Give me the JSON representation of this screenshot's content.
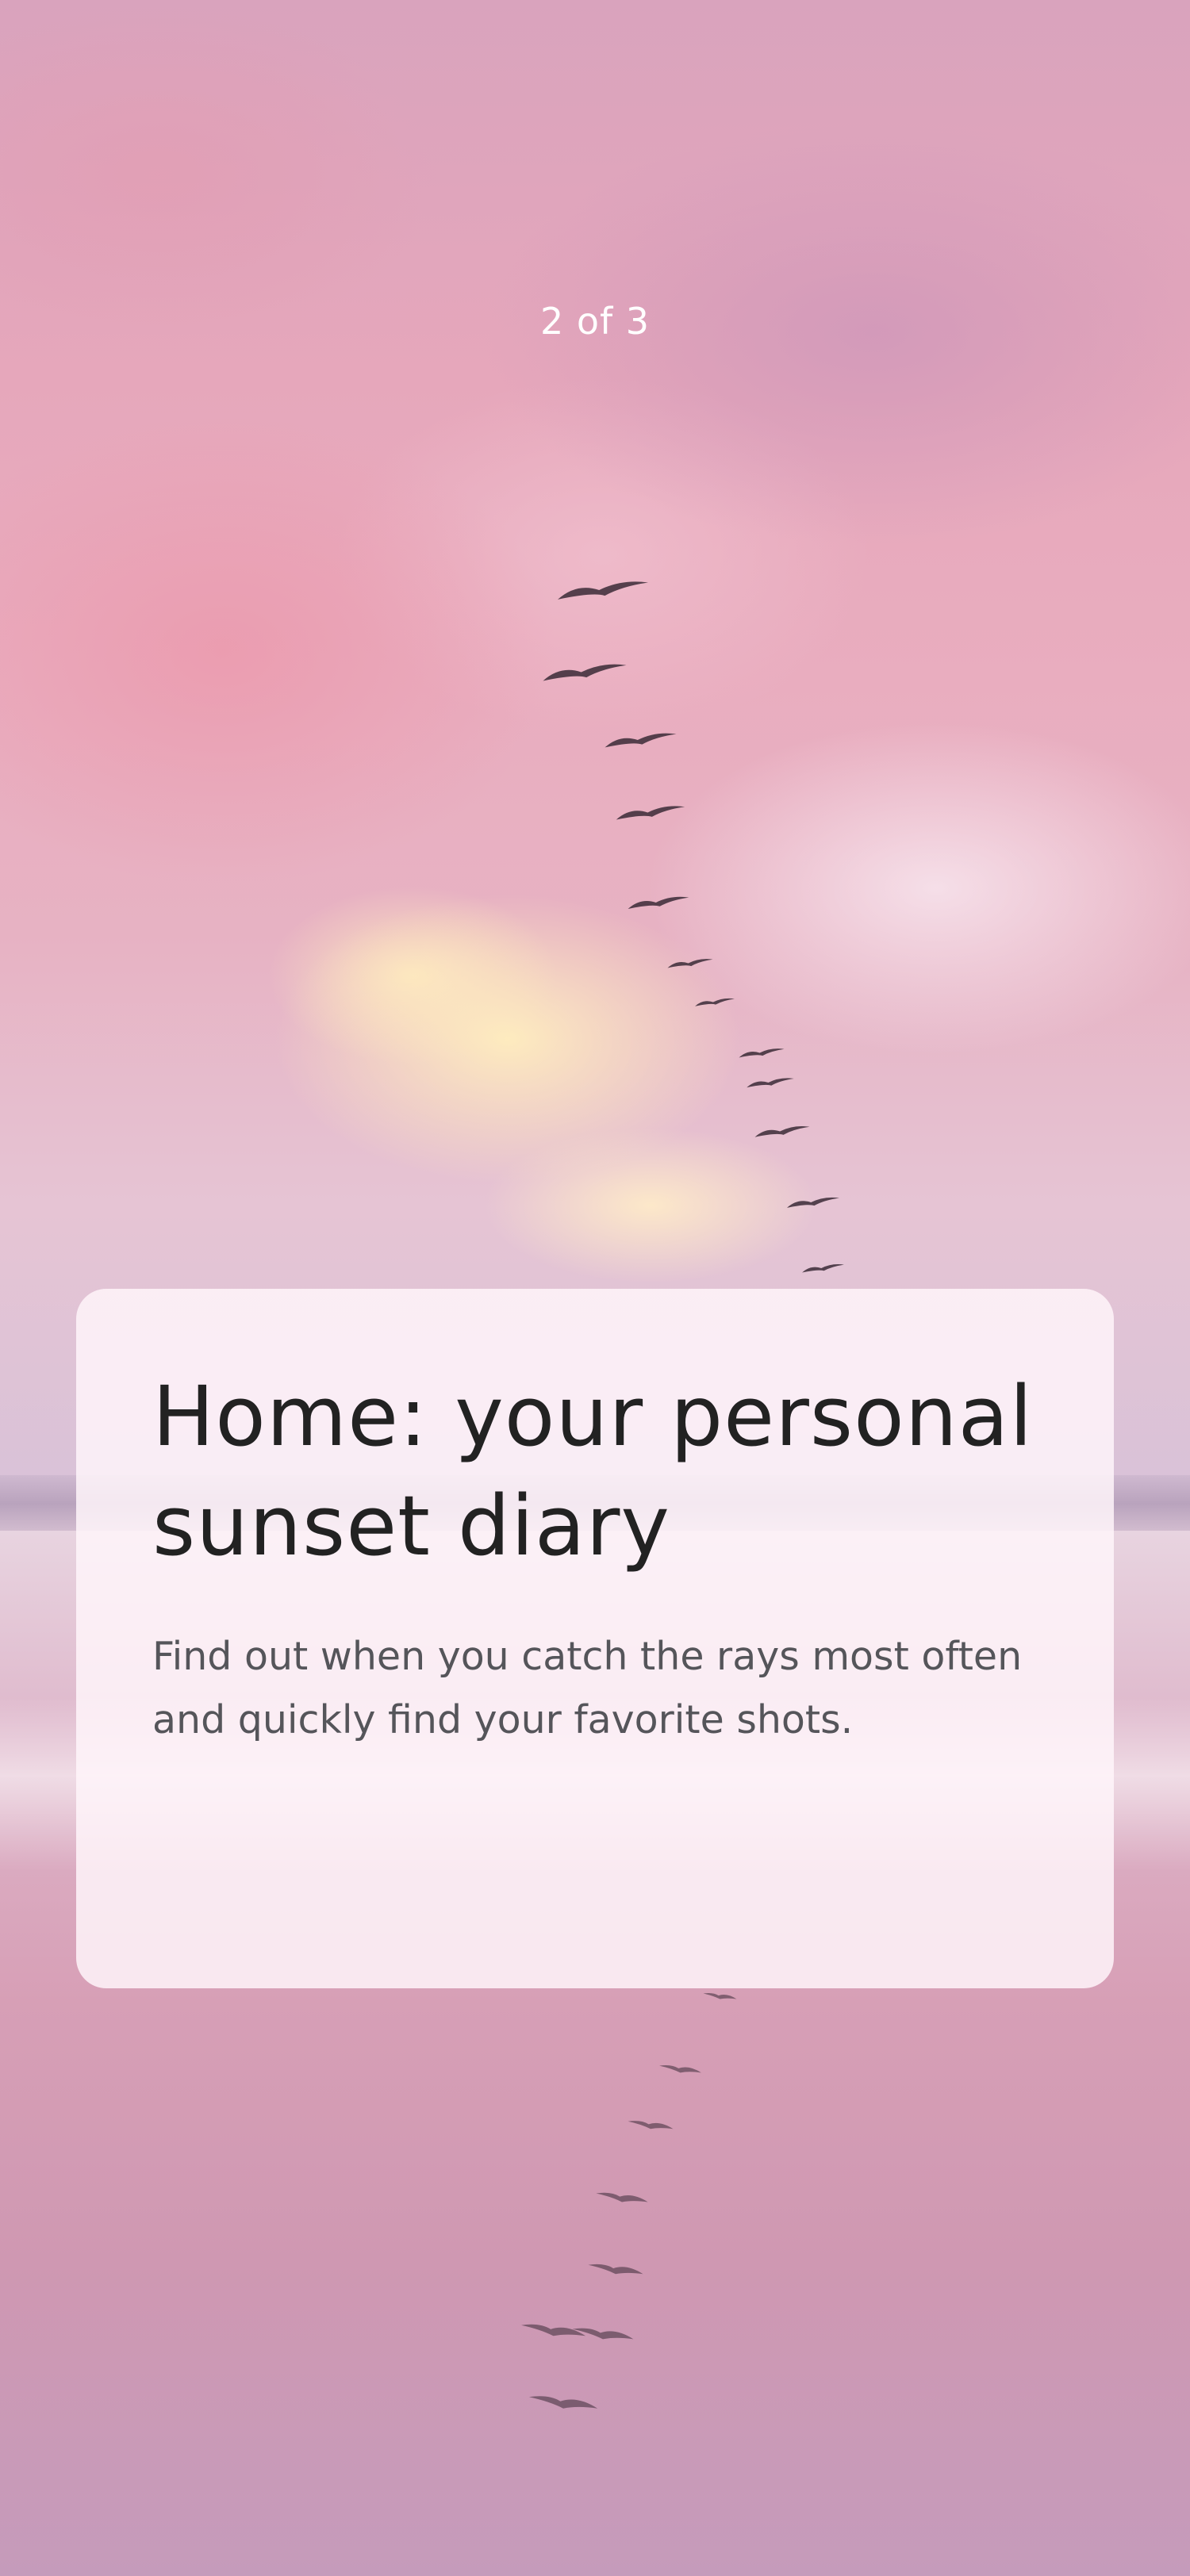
{
  "onboarding": {
    "page_indicator": "2 of 3",
    "card": {
      "title": "Home: your personal sunset diary",
      "body": "Find out when you catch the rays most often and quickly find your favorite shots."
    }
  },
  "background": {
    "image": "pink-sunset-sky-with-birds-over-beach",
    "icon": "flock-of-birds"
  },
  "colors": {
    "card_background": "#fff6fa",
    "title_text": "#222222",
    "body_text": "#55555a",
    "indicator_text": "#ffffff"
  }
}
